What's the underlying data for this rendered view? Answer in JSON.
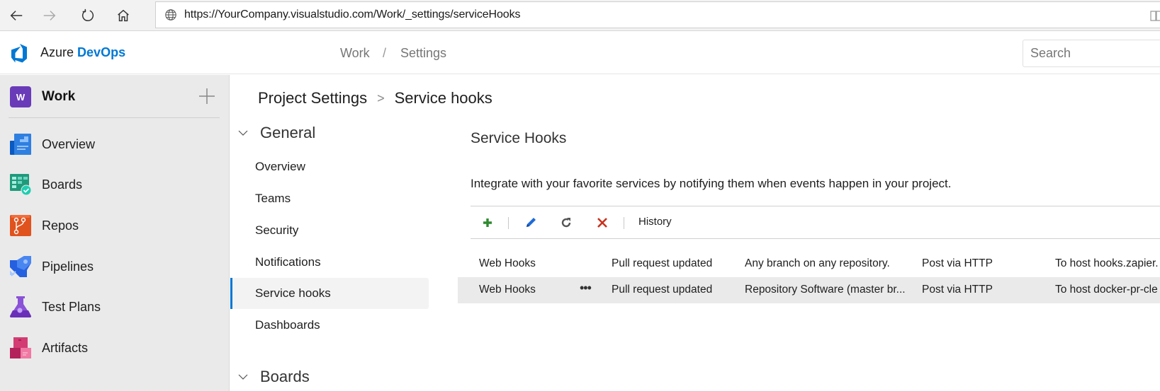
{
  "browser": {
    "url": "https://YourCompany.visualstudio.com/Work/_settings/serviceHooks",
    "icons": [
      "back-arrow-icon",
      "forward-arrow-icon",
      "refresh-icon",
      "home-icon",
      "globe-icon",
      "reading-view-icon"
    ]
  },
  "header": {
    "brand_prefix": "Azure",
    "brand_name": "DevOps",
    "breadcrumb": [
      "Work",
      "Settings"
    ],
    "breadcrumb_separator": "/",
    "search_placeholder": "Search"
  },
  "sidebar": {
    "project_initial": "W",
    "project_name": "Work",
    "project_color": "#6a3bb8",
    "items": [
      {
        "label": "Overview",
        "icon": "overview-icon"
      },
      {
        "label": "Boards",
        "icon": "boards-icon"
      },
      {
        "label": "Repos",
        "icon": "repos-icon"
      },
      {
        "label": "Pipelines",
        "icon": "pipelines-icon"
      },
      {
        "label": "Test Plans",
        "icon": "test-plans-icon"
      },
      {
        "label": "Artifacts",
        "icon": "artifacts-icon"
      }
    ]
  },
  "page": {
    "breadcrumb_root": "Project Settings",
    "breadcrumb_separator": ">",
    "breadcrumb_current": "Service hooks"
  },
  "settings_nav": {
    "groups": [
      {
        "label": "General",
        "expanded": true,
        "items": [
          "Overview",
          "Teams",
          "Security",
          "Notifications",
          "Service hooks",
          "Dashboards"
        ],
        "selected": "Service hooks"
      },
      {
        "label": "Boards",
        "expanded": true
      }
    ]
  },
  "main": {
    "title": "Service Hooks",
    "description": "Integrate with your favorite services by notifying them when events happen in your project.",
    "toolbar": {
      "add_icon": "plus-icon",
      "edit_icon": "pencil-icon",
      "refresh_icon": "refresh-icon",
      "delete_icon": "delete-x-icon",
      "history_label": "History"
    },
    "accent_color": "#0078d4",
    "subscriptions": [
      {
        "consumer": "Web Hooks",
        "event": "Pull request updated",
        "filter": "Any branch on any repository.",
        "action": "Post via HTTP",
        "target": "To host hooks.zapier."
      },
      {
        "consumer": "Web Hooks",
        "more_label": "•••",
        "event": "Pull request updated",
        "filter": "Repository Software (master br...",
        "action": "Post via HTTP",
        "target": "To host docker-pr-cle"
      }
    ]
  }
}
